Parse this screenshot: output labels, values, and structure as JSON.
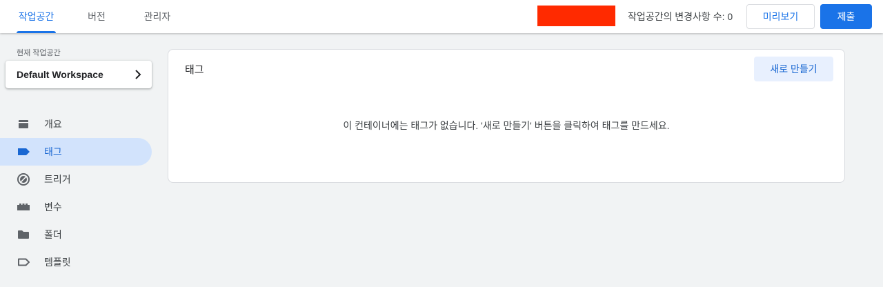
{
  "header": {
    "tabs": [
      {
        "label": "작업공간",
        "active": true
      },
      {
        "label": "버전",
        "active": false
      },
      {
        "label": "관리자",
        "active": false
      }
    ],
    "change_count_text": "작업공간의 변경사항 수: 0",
    "preview_label": "미리보기",
    "submit_label": "제출"
  },
  "sidebar": {
    "workspace_caption": "현재 작업공간",
    "workspace_name": "Default Workspace",
    "items": [
      {
        "label": "개요",
        "icon": "overview-icon",
        "active": false
      },
      {
        "label": "태그",
        "icon": "tag-icon",
        "active": true
      },
      {
        "label": "트리거",
        "icon": "trigger-icon",
        "active": false
      },
      {
        "label": "변수",
        "icon": "variable-icon",
        "active": false
      },
      {
        "label": "폴더",
        "icon": "folder-icon",
        "active": false
      },
      {
        "label": "템플릿",
        "icon": "template-icon",
        "active": false
      }
    ]
  },
  "main": {
    "card_title": "태그",
    "new_button_label": "새로 만들기",
    "empty_message": "이 컨테이너에는 태그가 없습니다. '새로 만들기' 버튼을 클릭하여 태그를 만드세요."
  },
  "colors": {
    "accent": "#1a73e8",
    "active_nav_bg": "#d2e3fc",
    "redacted": "#ff2a00",
    "background": "#f1f3f4"
  }
}
